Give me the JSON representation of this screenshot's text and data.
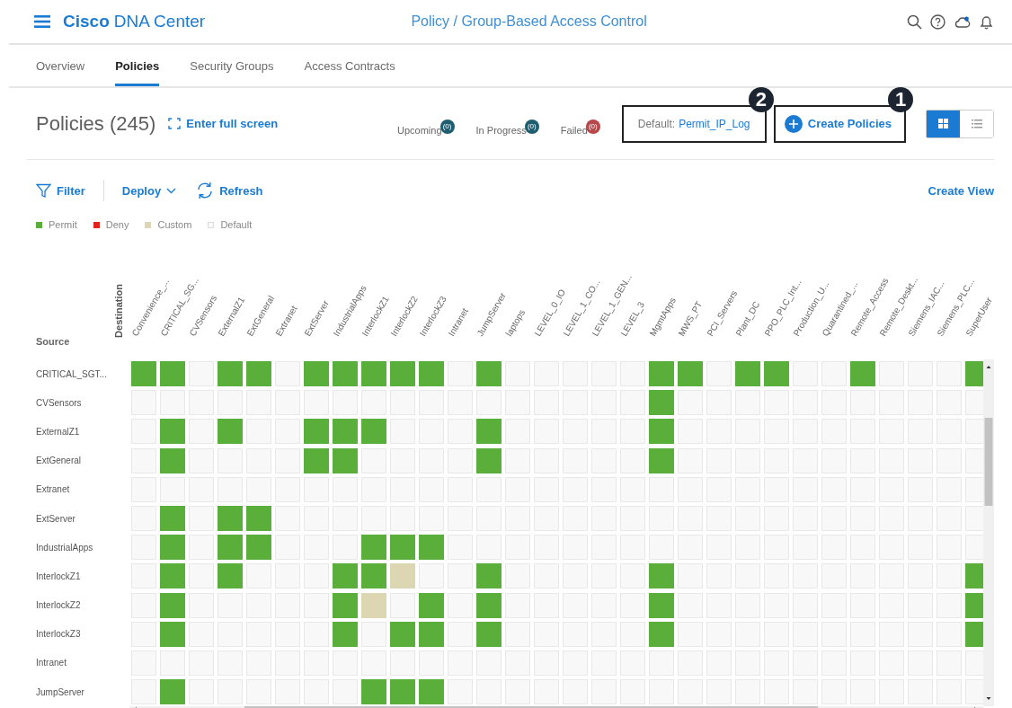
{
  "header": {
    "brand_bold": "Cisco",
    "brand": "DNA Center",
    "breadcrumb": "Policy / Group-Based Access Control"
  },
  "tabs": [
    {
      "label": "Overview",
      "selected": false
    },
    {
      "label": "Policies",
      "selected": true
    },
    {
      "label": "Security Groups",
      "selected": false
    },
    {
      "label": "Access Contracts",
      "selected": false
    }
  ],
  "page_title": "Policies (245)",
  "fullscreen_link": "Enter full screen",
  "deploy_status": [
    {
      "label": "Upcoming",
      "count": "(0)",
      "color": "#1f5e70"
    },
    {
      "label": "In Progress",
      "count": "(0)",
      "color": "#1f5e70"
    },
    {
      "label": "Failed",
      "count": "(0)",
      "color": "#b8474a"
    }
  ],
  "default_policy": {
    "label": "Default:",
    "value": "Permit_IP_Log",
    "callout": "2"
  },
  "create_button": {
    "label": "Create Policies",
    "callout": "1"
  },
  "view_toggle": [
    {
      "kind": "grid",
      "selected": true
    },
    {
      "kind": "list",
      "selected": false
    }
  ],
  "toolbar": {
    "filter": "Filter",
    "deploy": "Deploy",
    "refresh": "Refresh",
    "create_view": "Create View"
  },
  "legend": [
    {
      "kind": "permit",
      "label": "Permit",
      "color": "#5aaf3b"
    },
    {
      "kind": "deny",
      "label": "Deny",
      "color": "#e0231c"
    },
    {
      "kind": "custom",
      "label": "Custom",
      "color": "#ddd6b2"
    },
    {
      "kind": "default",
      "label": "Default",
      "color": "#f8f8f8"
    }
  ],
  "matrix": {
    "destination_label": "Destination",
    "source_label": "Source",
    "columns": [
      "Convenience_...",
      "CRITICAL_SG...",
      "CVSensors",
      "ExternalZ1",
      "ExtGeneral",
      "Extranet",
      "ExtServer",
      "IndustrialApps",
      "InterlockZ1",
      "InterlockZ2",
      "InterlockZ3",
      "Intranet",
      "JumpServer",
      "laptops",
      "LEVEL_0_IO",
      "LEVEL_1_CO...",
      "LEVEL_1_GEN...",
      "LEVEL_3",
      "MgmtApps",
      "MWS_PT",
      "PCI_Servers",
      "Plant_DC",
      "PPO_PLC_Int...",
      "Production_U...",
      "Quarantined_...",
      "Remote_Access",
      "Remote_Deskt...",
      "Siemens_IAC...",
      "Siemens_PLC...",
      "SuperUser"
    ],
    "rows": [
      {
        "name": "CRITICAL_SGT...",
        "cells": [
          {
            "kind": "permit"
          },
          {
            "kind": "permit"
          },
          {
            "kind": "default"
          },
          {
            "kind": "permit"
          },
          {
            "kind": "permit"
          },
          {
            "kind": "default"
          },
          {
            "kind": "permit"
          },
          {
            "kind": "permit"
          },
          {
            "kind": "permit"
          },
          {
            "kind": "permit"
          },
          {
            "kind": "permit"
          },
          {
            "kind": "default"
          },
          {
            "kind": "permit"
          },
          {
            "kind": "default"
          },
          {
            "kind": "default"
          },
          {
            "kind": "default"
          },
          {
            "kind": "default"
          },
          {
            "kind": "default"
          },
          {
            "kind": "permit"
          },
          {
            "kind": "permit"
          },
          {
            "kind": "default"
          },
          {
            "kind": "permit"
          },
          {
            "kind": "permit"
          },
          {
            "kind": "default"
          },
          {
            "kind": "default"
          },
          {
            "kind": "permit"
          },
          {
            "kind": "default"
          },
          {
            "kind": "default"
          },
          {
            "kind": "default"
          },
          {
            "kind": "permit"
          }
        ]
      },
      {
        "name": "CVSensors",
        "cells": [
          {
            "kind": "default"
          },
          {
            "kind": "default"
          },
          {
            "kind": "default"
          },
          {
            "kind": "default"
          },
          {
            "kind": "default"
          },
          {
            "kind": "default"
          },
          {
            "kind": "default"
          },
          {
            "kind": "default"
          },
          {
            "kind": "default"
          },
          {
            "kind": "default"
          },
          {
            "kind": "default"
          },
          {
            "kind": "default"
          },
          {
            "kind": "default"
          },
          {
            "kind": "default"
          },
          {
            "kind": "default"
          },
          {
            "kind": "default"
          },
          {
            "kind": "default"
          },
          {
            "kind": "default"
          },
          {
            "kind": "permit"
          },
          {
            "kind": "default"
          },
          {
            "kind": "default"
          },
          {
            "kind": "default"
          },
          {
            "kind": "default"
          },
          {
            "kind": "default"
          },
          {
            "kind": "default"
          },
          {
            "kind": "default"
          },
          {
            "kind": "default"
          },
          {
            "kind": "default"
          },
          {
            "kind": "default"
          },
          {
            "kind": "default"
          }
        ]
      },
      {
        "name": "ExternalZ1",
        "cells": [
          {
            "kind": "default"
          },
          {
            "kind": "permit"
          },
          {
            "kind": "default"
          },
          {
            "kind": "permit"
          },
          {
            "kind": "default"
          },
          {
            "kind": "default"
          },
          {
            "kind": "permit"
          },
          {
            "kind": "permit"
          },
          {
            "kind": "permit"
          },
          {
            "kind": "default"
          },
          {
            "kind": "default"
          },
          {
            "kind": "default"
          },
          {
            "kind": "permit"
          },
          {
            "kind": "default"
          },
          {
            "kind": "default"
          },
          {
            "kind": "default"
          },
          {
            "kind": "default"
          },
          {
            "kind": "default"
          },
          {
            "kind": "permit"
          },
          {
            "kind": "default"
          },
          {
            "kind": "default"
          },
          {
            "kind": "default"
          },
          {
            "kind": "default"
          },
          {
            "kind": "default"
          },
          {
            "kind": "default"
          },
          {
            "kind": "default"
          },
          {
            "kind": "default"
          },
          {
            "kind": "default"
          },
          {
            "kind": "default"
          },
          {
            "kind": "default"
          }
        ]
      },
      {
        "name": "ExtGeneral",
        "cells": [
          {
            "kind": "default"
          },
          {
            "kind": "permit"
          },
          {
            "kind": "default"
          },
          {
            "kind": "default"
          },
          {
            "kind": "default"
          },
          {
            "kind": "default"
          },
          {
            "kind": "permit"
          },
          {
            "kind": "permit"
          },
          {
            "kind": "default"
          },
          {
            "kind": "default"
          },
          {
            "kind": "default"
          },
          {
            "kind": "default"
          },
          {
            "kind": "permit"
          },
          {
            "kind": "default"
          },
          {
            "kind": "default"
          },
          {
            "kind": "default"
          },
          {
            "kind": "default"
          },
          {
            "kind": "default"
          },
          {
            "kind": "permit"
          },
          {
            "kind": "default"
          },
          {
            "kind": "default"
          },
          {
            "kind": "default"
          },
          {
            "kind": "default"
          },
          {
            "kind": "default"
          },
          {
            "kind": "default"
          },
          {
            "kind": "default"
          },
          {
            "kind": "default"
          },
          {
            "kind": "default"
          },
          {
            "kind": "default"
          },
          {
            "kind": "default"
          }
        ]
      },
      {
        "name": "Extranet",
        "cells": [
          {
            "kind": "default"
          },
          {
            "kind": "default"
          },
          {
            "kind": "default"
          },
          {
            "kind": "default"
          },
          {
            "kind": "default"
          },
          {
            "kind": "default"
          },
          {
            "kind": "default"
          },
          {
            "kind": "default"
          },
          {
            "kind": "default"
          },
          {
            "kind": "default"
          },
          {
            "kind": "default"
          },
          {
            "kind": "default"
          },
          {
            "kind": "default"
          },
          {
            "kind": "default"
          },
          {
            "kind": "default"
          },
          {
            "kind": "default"
          },
          {
            "kind": "default"
          },
          {
            "kind": "default"
          },
          {
            "kind": "default"
          },
          {
            "kind": "default"
          },
          {
            "kind": "default"
          },
          {
            "kind": "default"
          },
          {
            "kind": "default"
          },
          {
            "kind": "default"
          },
          {
            "kind": "default"
          },
          {
            "kind": "default"
          },
          {
            "kind": "default"
          },
          {
            "kind": "default"
          },
          {
            "kind": "default"
          },
          {
            "kind": "default"
          }
        ]
      },
      {
        "name": "ExtServer",
        "cells": [
          {
            "kind": "default"
          },
          {
            "kind": "permit"
          },
          {
            "kind": "default"
          },
          {
            "kind": "permit"
          },
          {
            "kind": "permit"
          },
          {
            "kind": "default"
          },
          {
            "kind": "default"
          },
          {
            "kind": "default"
          },
          {
            "kind": "default"
          },
          {
            "kind": "default"
          },
          {
            "kind": "default"
          },
          {
            "kind": "default"
          },
          {
            "kind": "default"
          },
          {
            "kind": "default"
          },
          {
            "kind": "default"
          },
          {
            "kind": "default"
          },
          {
            "kind": "default"
          },
          {
            "kind": "default"
          },
          {
            "kind": "default"
          },
          {
            "kind": "default"
          },
          {
            "kind": "default"
          },
          {
            "kind": "default"
          },
          {
            "kind": "default"
          },
          {
            "kind": "default"
          },
          {
            "kind": "default"
          },
          {
            "kind": "default"
          },
          {
            "kind": "default"
          },
          {
            "kind": "default"
          },
          {
            "kind": "default"
          },
          {
            "kind": "default"
          }
        ]
      },
      {
        "name": "IndustrialApps",
        "cells": [
          {
            "kind": "default"
          },
          {
            "kind": "permit"
          },
          {
            "kind": "default"
          },
          {
            "kind": "permit"
          },
          {
            "kind": "permit"
          },
          {
            "kind": "default"
          },
          {
            "kind": "default"
          },
          {
            "kind": "default"
          },
          {
            "kind": "permit"
          },
          {
            "kind": "permit"
          },
          {
            "kind": "permit"
          },
          {
            "kind": "default"
          },
          {
            "kind": "default"
          },
          {
            "kind": "default"
          },
          {
            "kind": "default"
          },
          {
            "kind": "default"
          },
          {
            "kind": "default"
          },
          {
            "kind": "default"
          },
          {
            "kind": "default"
          },
          {
            "kind": "default"
          },
          {
            "kind": "default"
          },
          {
            "kind": "default"
          },
          {
            "kind": "default"
          },
          {
            "kind": "default"
          },
          {
            "kind": "default"
          },
          {
            "kind": "default"
          },
          {
            "kind": "default"
          },
          {
            "kind": "default"
          },
          {
            "kind": "default"
          },
          {
            "kind": "default"
          }
        ]
      },
      {
        "name": "InterlockZ1",
        "cells": [
          {
            "kind": "default"
          },
          {
            "kind": "permit"
          },
          {
            "kind": "default"
          },
          {
            "kind": "permit"
          },
          {
            "kind": "default"
          },
          {
            "kind": "default"
          },
          {
            "kind": "default"
          },
          {
            "kind": "permit"
          },
          {
            "kind": "permit"
          },
          {
            "kind": "custom"
          },
          {
            "kind": "default"
          },
          {
            "kind": "default"
          },
          {
            "kind": "permit"
          },
          {
            "kind": "default"
          },
          {
            "kind": "default"
          },
          {
            "kind": "default"
          },
          {
            "kind": "default"
          },
          {
            "kind": "default"
          },
          {
            "kind": "permit"
          },
          {
            "kind": "default"
          },
          {
            "kind": "default"
          },
          {
            "kind": "default"
          },
          {
            "kind": "default"
          },
          {
            "kind": "default"
          },
          {
            "kind": "default"
          },
          {
            "kind": "default"
          },
          {
            "kind": "default"
          },
          {
            "kind": "default"
          },
          {
            "kind": "default"
          },
          {
            "kind": "permit"
          }
        ]
      },
      {
        "name": "InterlockZ2",
        "cells": [
          {
            "kind": "default"
          },
          {
            "kind": "permit"
          },
          {
            "kind": "default"
          },
          {
            "kind": "default"
          },
          {
            "kind": "default"
          },
          {
            "kind": "default"
          },
          {
            "kind": "default"
          },
          {
            "kind": "permit"
          },
          {
            "kind": "custom"
          },
          {
            "kind": "default"
          },
          {
            "kind": "permit"
          },
          {
            "kind": "default"
          },
          {
            "kind": "permit"
          },
          {
            "kind": "default"
          },
          {
            "kind": "default"
          },
          {
            "kind": "default"
          },
          {
            "kind": "default"
          },
          {
            "kind": "default"
          },
          {
            "kind": "permit"
          },
          {
            "kind": "default"
          },
          {
            "kind": "default"
          },
          {
            "kind": "default"
          },
          {
            "kind": "default"
          },
          {
            "kind": "default"
          },
          {
            "kind": "default"
          },
          {
            "kind": "default"
          },
          {
            "kind": "default"
          },
          {
            "kind": "default"
          },
          {
            "kind": "default"
          },
          {
            "kind": "permit"
          }
        ]
      },
      {
        "name": "InterlockZ3",
        "cells": [
          {
            "kind": "default"
          },
          {
            "kind": "permit"
          },
          {
            "kind": "default"
          },
          {
            "kind": "default"
          },
          {
            "kind": "default"
          },
          {
            "kind": "default"
          },
          {
            "kind": "default"
          },
          {
            "kind": "permit"
          },
          {
            "kind": "default"
          },
          {
            "kind": "permit"
          },
          {
            "kind": "permit"
          },
          {
            "kind": "default"
          },
          {
            "kind": "permit"
          },
          {
            "kind": "default"
          },
          {
            "kind": "default"
          },
          {
            "kind": "default"
          },
          {
            "kind": "default"
          },
          {
            "kind": "default"
          },
          {
            "kind": "permit"
          },
          {
            "kind": "default"
          },
          {
            "kind": "default"
          },
          {
            "kind": "default"
          },
          {
            "kind": "default"
          },
          {
            "kind": "default"
          },
          {
            "kind": "default"
          },
          {
            "kind": "default"
          },
          {
            "kind": "default"
          },
          {
            "kind": "default"
          },
          {
            "kind": "default"
          },
          {
            "kind": "permit"
          }
        ]
      },
      {
        "name": "Intranet",
        "cells": [
          {
            "kind": "default"
          },
          {
            "kind": "default"
          },
          {
            "kind": "default"
          },
          {
            "kind": "default"
          },
          {
            "kind": "default"
          },
          {
            "kind": "default"
          },
          {
            "kind": "default"
          },
          {
            "kind": "default"
          },
          {
            "kind": "default"
          },
          {
            "kind": "default"
          },
          {
            "kind": "default"
          },
          {
            "kind": "default"
          },
          {
            "kind": "default"
          },
          {
            "kind": "default"
          },
          {
            "kind": "default"
          },
          {
            "kind": "default"
          },
          {
            "kind": "default"
          },
          {
            "kind": "default"
          },
          {
            "kind": "default"
          },
          {
            "kind": "default"
          },
          {
            "kind": "default"
          },
          {
            "kind": "default"
          },
          {
            "kind": "default"
          },
          {
            "kind": "default"
          },
          {
            "kind": "default"
          },
          {
            "kind": "default"
          },
          {
            "kind": "default"
          },
          {
            "kind": "default"
          },
          {
            "kind": "default"
          },
          {
            "kind": "default"
          }
        ]
      },
      {
        "name": "JumpServer",
        "cells": [
          {
            "kind": "default"
          },
          {
            "kind": "permit"
          },
          {
            "kind": "default"
          },
          {
            "kind": "default"
          },
          {
            "kind": "default"
          },
          {
            "kind": "default"
          },
          {
            "kind": "default"
          },
          {
            "kind": "default"
          },
          {
            "kind": "permit"
          },
          {
            "kind": "permit"
          },
          {
            "kind": "permit"
          },
          {
            "kind": "default"
          },
          {
            "kind": "default"
          },
          {
            "kind": "default"
          },
          {
            "kind": "default"
          },
          {
            "kind": "default"
          },
          {
            "kind": "default"
          },
          {
            "kind": "default"
          },
          {
            "kind": "default"
          },
          {
            "kind": "default"
          },
          {
            "kind": "default"
          },
          {
            "kind": "default"
          },
          {
            "kind": "default"
          },
          {
            "kind": "default"
          },
          {
            "kind": "default"
          },
          {
            "kind": "default"
          },
          {
            "kind": "default"
          },
          {
            "kind": "default"
          },
          {
            "kind": "default"
          },
          {
            "kind": "default"
          }
        ]
      }
    ]
  }
}
